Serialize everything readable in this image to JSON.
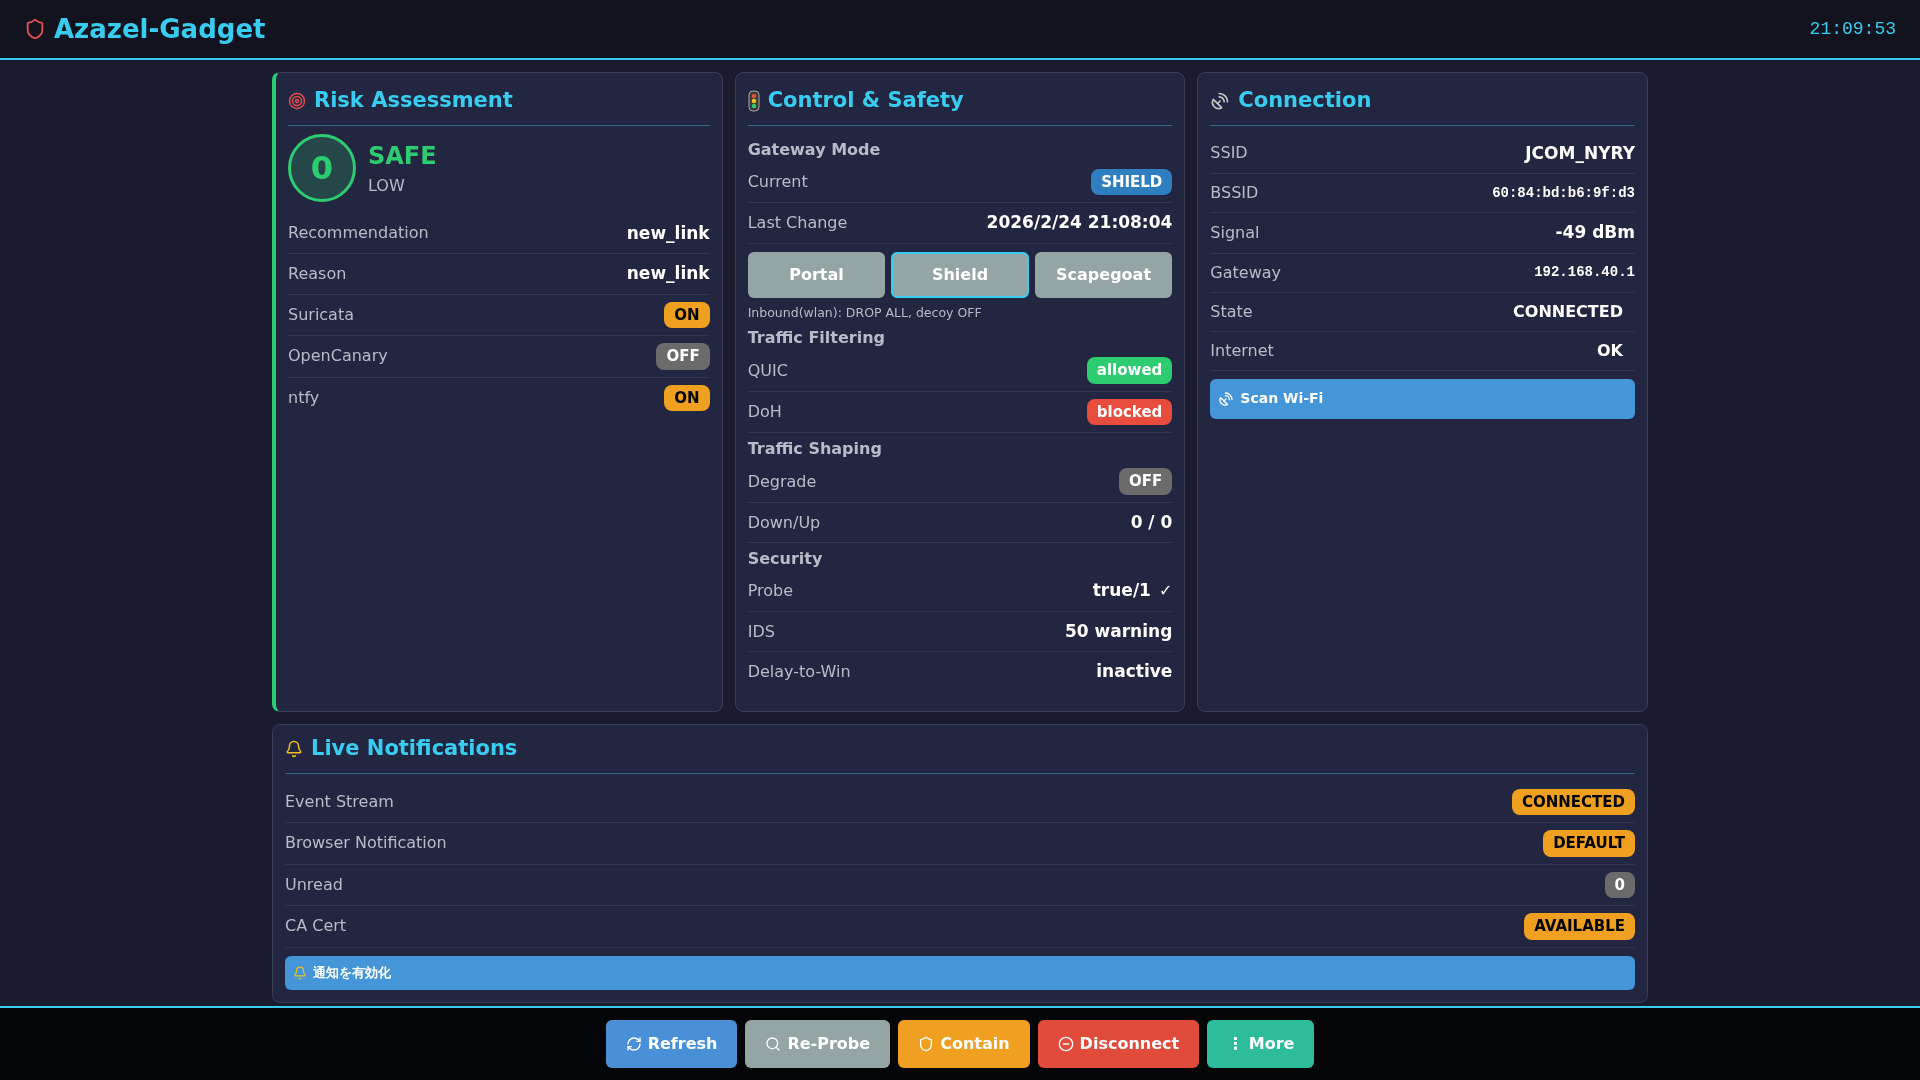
{
  "header": {
    "title": "Azazel-Gadget",
    "clock": "21:09:53"
  },
  "risk": {
    "title": "Risk Assessment",
    "score": "0",
    "status": "SAFE",
    "level_label": "LOW",
    "color": "#2ecc71",
    "rows": [
      {
        "label": "Recommendation",
        "value": "new_link",
        "kind": "text"
      },
      {
        "label": "Reason",
        "value": "new_link",
        "kind": "text"
      },
      {
        "label": "Suricata",
        "value": "ON",
        "kind": "badge",
        "color": "#f0a020"
      },
      {
        "label": "OpenCanary",
        "value": "OFF",
        "kind": "badge",
        "color": "#6b6b6b"
      },
      {
        "label": "ntfy",
        "value": "ON",
        "kind": "badge",
        "color": "#f0a020"
      }
    ]
  },
  "control": {
    "title": "Control & Safety",
    "sections": [
      {
        "heading": "Gateway Mode",
        "rows": [
          {
            "label": "Current",
            "value": "SHIELD",
            "kind": "badge",
            "color": "#2f7fc0"
          },
          {
            "label": "Last Change",
            "value": "2026/2/24 21:08:04",
            "kind": "text"
          }
        ],
        "modes": [
          {
            "label": "Portal",
            "selected": false
          },
          {
            "label": "Shield",
            "selected": true
          },
          {
            "label": "Scapegoat",
            "selected": false
          }
        ],
        "note": "Inbound(wlan): DROP ALL, decoy OFF"
      },
      {
        "heading": "Traffic Filtering",
        "rows": [
          {
            "label": "QUIC",
            "value": "allowed",
            "kind": "badge",
            "color": "#2ecc71"
          },
          {
            "label": "DoH",
            "value": "blocked",
            "kind": "badge",
            "color": "#e74c3c"
          }
        ]
      },
      {
        "heading": "Traffic Shaping",
        "rows": [
          {
            "label": "Degrade",
            "value": "OFF",
            "kind": "badge",
            "color": "#6b6b6b"
          },
          {
            "label": "Down/Up",
            "value": "0 / 0",
            "kind": "text"
          }
        ]
      },
      {
        "heading": "Security",
        "rows": [
          {
            "label": "Probe",
            "value": "true/1",
            "suffix": "✓",
            "kind": "text"
          },
          {
            "label": "IDS",
            "value": "50 warning",
            "kind": "text"
          },
          {
            "label": "Delay-to-Win",
            "value": "inactive",
            "kind": "text"
          }
        ]
      }
    ]
  },
  "connection": {
    "title": "Connection",
    "rows": [
      {
        "label": "SSID",
        "value": "JCOM_NYRY",
        "kind": "text"
      },
      {
        "label": "BSSID",
        "value": "60:84:bd:b6:9f:d3",
        "kind": "mono"
      },
      {
        "label": "Signal",
        "value": "-49 dBm",
        "kind": "text"
      },
      {
        "label": "Gateway",
        "value": "192.168.40.1",
        "kind": "mono"
      },
      {
        "label": "State",
        "value": "CONNECTED",
        "kind": "status"
      },
      {
        "label": "Internet",
        "value": "OK",
        "kind": "status"
      }
    ],
    "scan_button": "Scan Wi-Fi"
  },
  "notifications": {
    "title": "Live Notifications",
    "rows": [
      {
        "label": "Event Stream",
        "value": "CONNECTED",
        "kind": "badge",
        "color": "#f0a020"
      },
      {
        "label": "Browser Notification",
        "value": "DEFAULT",
        "kind": "badge",
        "color": "#f0a020"
      },
      {
        "label": "Unread",
        "value": "0",
        "kind": "badge",
        "color": "#6b6b6b"
      },
      {
        "label": "CA Cert",
        "value": "AVAILABLE",
        "kind": "badge",
        "color": "#f0a020"
      }
    ],
    "enable_button": "通知を有効化"
  },
  "actions": [
    {
      "label": "Refresh",
      "color": "#4a90d9"
    },
    {
      "label": "Re-Probe",
      "color": "#95a5a6"
    },
    {
      "label": "Contain",
      "color": "#f0a020"
    },
    {
      "label": "Disconnect",
      "color": "#e04b3c"
    },
    {
      "label": "⋮ More",
      "color": "#2ebd9b"
    }
  ]
}
